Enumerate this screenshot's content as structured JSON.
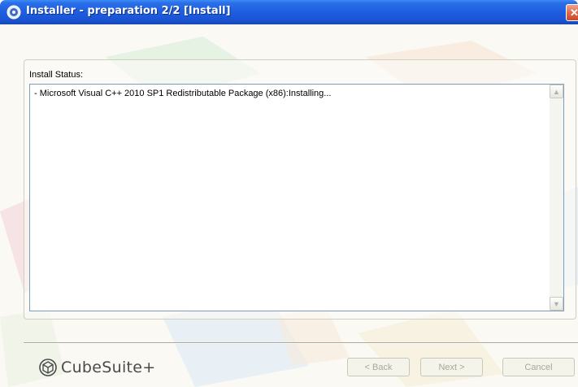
{
  "window": {
    "title": "Installer - preparation 2/2 [Install]",
    "close_glyph": "✕",
    "title_icon": "installer-disc-icon"
  },
  "group": {
    "label": "Install Status:"
  },
  "status": {
    "lines": [
      "- Microsoft Visual C++ 2010 SP1 Redistributable Package (x86):Installing..."
    ],
    "scroll_up_glyph": "▲",
    "scroll_down_glyph": "▼"
  },
  "footer": {
    "logo_text": "CubeSuite+",
    "back_label": "< Back",
    "next_label": "Next >",
    "cancel_label": "Cancel"
  },
  "colors": {
    "titlebar": "#1f5fe0",
    "disabled_text": "#a9a79a"
  }
}
